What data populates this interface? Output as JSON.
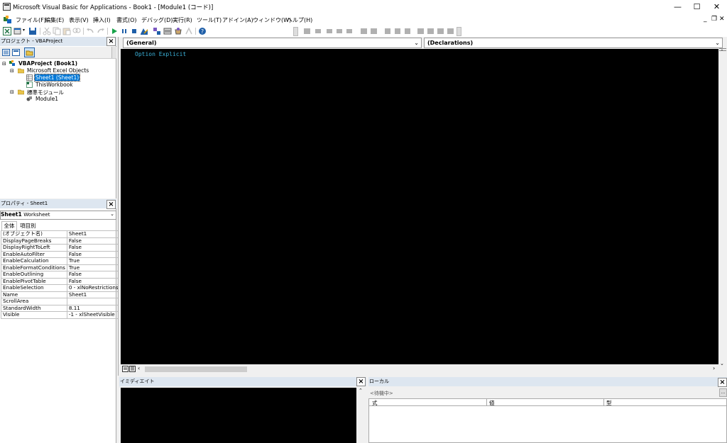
{
  "window": {
    "title": "Microsoft Visual Basic for Applications - Book1 - [Module1 (コード)]",
    "controls": {
      "minimize": "—",
      "maximize": "☐",
      "close": "✕"
    }
  },
  "menu": {
    "items": [
      "ファイル(F)",
      "編集(E)",
      "表示(V)",
      "挿入(I)",
      "書式(O)",
      "デバッグ(D)",
      "実行(R)",
      "ツール(T)",
      "アドイン(A)",
      "ウィンドウ(W)",
      "ヘルプ(H)"
    ],
    "mdi_minimize": "_",
    "mdi_restore": "❐",
    "mdi_close": "✕"
  },
  "project": {
    "title": "プロジェクト - VBAProject",
    "tree": {
      "root": "VBAProject (Book1)",
      "excel_folder": "Microsoft Excel Objects",
      "sheet": "Sheet1 (Sheet1)",
      "workbook": "ThisWorkbook",
      "module_folder": "標準モジュール",
      "module": "Module1"
    }
  },
  "properties": {
    "title": "プロパティ - Sheet1",
    "object_name": "Sheet1",
    "object_type": "Worksheet",
    "tabs": [
      "全体",
      "項目別"
    ],
    "rows": [
      [
        "(オブジェクト名)",
        "Sheet1"
      ],
      [
        "DisplayPageBreaks",
        "False"
      ],
      [
        "DisplayRightToLeft",
        "False"
      ],
      [
        "EnableAutoFilter",
        "False"
      ],
      [
        "EnableCalculation",
        "True"
      ],
      [
        "EnableFormatConditions",
        "True"
      ],
      [
        "EnableOutlining",
        "False"
      ],
      [
        "EnablePivotTable",
        "False"
      ],
      [
        "EnableSelection",
        "0 - xlNoRestrictions"
      ],
      [
        "Name",
        "Sheet1"
      ],
      [
        "ScrollArea",
        ""
      ],
      [
        "StandardWidth",
        "8.11"
      ],
      [
        "Visible",
        "-1 - xlSheetVisible"
      ]
    ]
  },
  "code": {
    "object_combo": "(General)",
    "proc_combo": "(Declarations)",
    "lines": [
      "Option Explicit"
    ]
  },
  "immediate": {
    "title": "イミディエイト"
  },
  "locals": {
    "title": "ローカル",
    "status": "<待機中>",
    "columns": [
      "式",
      "値",
      "型"
    ]
  },
  "colors": {
    "code_bg": "#000000",
    "code_text": "#3cb4dc",
    "selection": "#0078d7",
    "pane_header": "#dde6f0"
  },
  "icons": [
    "vba-app-icon",
    "excel-icon",
    "save-icon",
    "run-icon",
    "pause-icon",
    "stop-icon",
    "design-mode-icon",
    "help-icon"
  ]
}
